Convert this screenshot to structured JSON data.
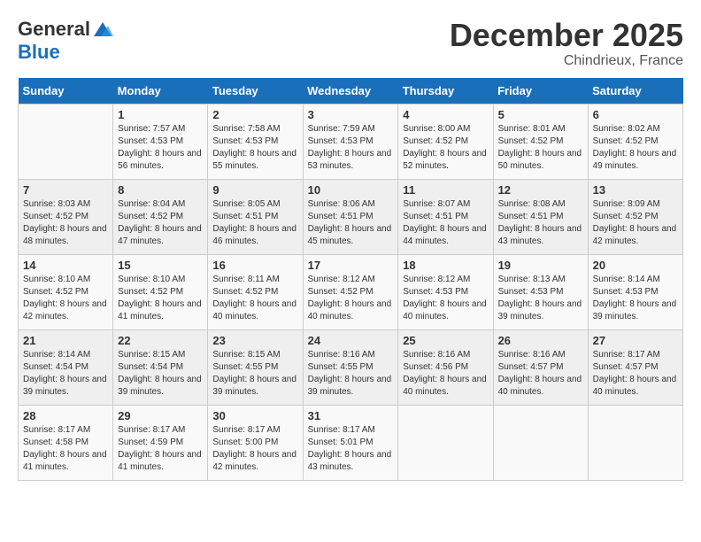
{
  "logo": {
    "general": "General",
    "blue": "Blue"
  },
  "title": "December 2025",
  "location": "Chindrieux, France",
  "days_header": [
    "Sunday",
    "Monday",
    "Tuesday",
    "Wednesday",
    "Thursday",
    "Friday",
    "Saturday"
  ],
  "weeks": [
    [
      {
        "day": "",
        "sunrise": "",
        "sunset": "",
        "daylight": ""
      },
      {
        "day": "1",
        "sunrise": "Sunrise: 7:57 AM",
        "sunset": "Sunset: 4:53 PM",
        "daylight": "Daylight: 8 hours and 56 minutes."
      },
      {
        "day": "2",
        "sunrise": "Sunrise: 7:58 AM",
        "sunset": "Sunset: 4:53 PM",
        "daylight": "Daylight: 8 hours and 55 minutes."
      },
      {
        "day": "3",
        "sunrise": "Sunrise: 7:59 AM",
        "sunset": "Sunset: 4:53 PM",
        "daylight": "Daylight: 8 hours and 53 minutes."
      },
      {
        "day": "4",
        "sunrise": "Sunrise: 8:00 AM",
        "sunset": "Sunset: 4:52 PM",
        "daylight": "Daylight: 8 hours and 52 minutes."
      },
      {
        "day": "5",
        "sunrise": "Sunrise: 8:01 AM",
        "sunset": "Sunset: 4:52 PM",
        "daylight": "Daylight: 8 hours and 50 minutes."
      },
      {
        "day": "6",
        "sunrise": "Sunrise: 8:02 AM",
        "sunset": "Sunset: 4:52 PM",
        "daylight": "Daylight: 8 hours and 49 minutes."
      }
    ],
    [
      {
        "day": "7",
        "sunrise": "Sunrise: 8:03 AM",
        "sunset": "Sunset: 4:52 PM",
        "daylight": "Daylight: 8 hours and 48 minutes."
      },
      {
        "day": "8",
        "sunrise": "Sunrise: 8:04 AM",
        "sunset": "Sunset: 4:52 PM",
        "daylight": "Daylight: 8 hours and 47 minutes."
      },
      {
        "day": "9",
        "sunrise": "Sunrise: 8:05 AM",
        "sunset": "Sunset: 4:51 PM",
        "daylight": "Daylight: 8 hours and 46 minutes."
      },
      {
        "day": "10",
        "sunrise": "Sunrise: 8:06 AM",
        "sunset": "Sunset: 4:51 PM",
        "daylight": "Daylight: 8 hours and 45 minutes."
      },
      {
        "day": "11",
        "sunrise": "Sunrise: 8:07 AM",
        "sunset": "Sunset: 4:51 PM",
        "daylight": "Daylight: 8 hours and 44 minutes."
      },
      {
        "day": "12",
        "sunrise": "Sunrise: 8:08 AM",
        "sunset": "Sunset: 4:51 PM",
        "daylight": "Daylight: 8 hours and 43 minutes."
      },
      {
        "day": "13",
        "sunrise": "Sunrise: 8:09 AM",
        "sunset": "Sunset: 4:52 PM",
        "daylight": "Daylight: 8 hours and 42 minutes."
      }
    ],
    [
      {
        "day": "14",
        "sunrise": "Sunrise: 8:10 AM",
        "sunset": "Sunset: 4:52 PM",
        "daylight": "Daylight: 8 hours and 42 minutes."
      },
      {
        "day": "15",
        "sunrise": "Sunrise: 8:10 AM",
        "sunset": "Sunset: 4:52 PM",
        "daylight": "Daylight: 8 hours and 41 minutes."
      },
      {
        "day": "16",
        "sunrise": "Sunrise: 8:11 AM",
        "sunset": "Sunset: 4:52 PM",
        "daylight": "Daylight: 8 hours and 40 minutes."
      },
      {
        "day": "17",
        "sunrise": "Sunrise: 8:12 AM",
        "sunset": "Sunset: 4:52 PM",
        "daylight": "Daylight: 8 hours and 40 minutes."
      },
      {
        "day": "18",
        "sunrise": "Sunrise: 8:12 AM",
        "sunset": "Sunset: 4:53 PM",
        "daylight": "Daylight: 8 hours and 40 minutes."
      },
      {
        "day": "19",
        "sunrise": "Sunrise: 8:13 AM",
        "sunset": "Sunset: 4:53 PM",
        "daylight": "Daylight: 8 hours and 39 minutes."
      },
      {
        "day": "20",
        "sunrise": "Sunrise: 8:14 AM",
        "sunset": "Sunset: 4:53 PM",
        "daylight": "Daylight: 8 hours and 39 minutes."
      }
    ],
    [
      {
        "day": "21",
        "sunrise": "Sunrise: 8:14 AM",
        "sunset": "Sunset: 4:54 PM",
        "daylight": "Daylight: 8 hours and 39 minutes."
      },
      {
        "day": "22",
        "sunrise": "Sunrise: 8:15 AM",
        "sunset": "Sunset: 4:54 PM",
        "daylight": "Daylight: 8 hours and 39 minutes."
      },
      {
        "day": "23",
        "sunrise": "Sunrise: 8:15 AM",
        "sunset": "Sunset: 4:55 PM",
        "daylight": "Daylight: 8 hours and 39 minutes."
      },
      {
        "day": "24",
        "sunrise": "Sunrise: 8:16 AM",
        "sunset": "Sunset: 4:55 PM",
        "daylight": "Daylight: 8 hours and 39 minutes."
      },
      {
        "day": "25",
        "sunrise": "Sunrise: 8:16 AM",
        "sunset": "Sunset: 4:56 PM",
        "daylight": "Daylight: 8 hours and 40 minutes."
      },
      {
        "day": "26",
        "sunrise": "Sunrise: 8:16 AM",
        "sunset": "Sunset: 4:57 PM",
        "daylight": "Daylight: 8 hours and 40 minutes."
      },
      {
        "day": "27",
        "sunrise": "Sunrise: 8:17 AM",
        "sunset": "Sunset: 4:57 PM",
        "daylight": "Daylight: 8 hours and 40 minutes."
      }
    ],
    [
      {
        "day": "28",
        "sunrise": "Sunrise: 8:17 AM",
        "sunset": "Sunset: 4:58 PM",
        "daylight": "Daylight: 8 hours and 41 minutes."
      },
      {
        "day": "29",
        "sunrise": "Sunrise: 8:17 AM",
        "sunset": "Sunset: 4:59 PM",
        "daylight": "Daylight: 8 hours and 41 minutes."
      },
      {
        "day": "30",
        "sunrise": "Sunrise: 8:17 AM",
        "sunset": "Sunset: 5:00 PM",
        "daylight": "Daylight: 8 hours and 42 minutes."
      },
      {
        "day": "31",
        "sunrise": "Sunrise: 8:17 AM",
        "sunset": "Sunset: 5:01 PM",
        "daylight": "Daylight: 8 hours and 43 minutes."
      },
      {
        "day": "",
        "sunrise": "",
        "sunset": "",
        "daylight": ""
      },
      {
        "day": "",
        "sunrise": "",
        "sunset": "",
        "daylight": ""
      },
      {
        "day": "",
        "sunrise": "",
        "sunset": "",
        "daylight": ""
      }
    ]
  ]
}
